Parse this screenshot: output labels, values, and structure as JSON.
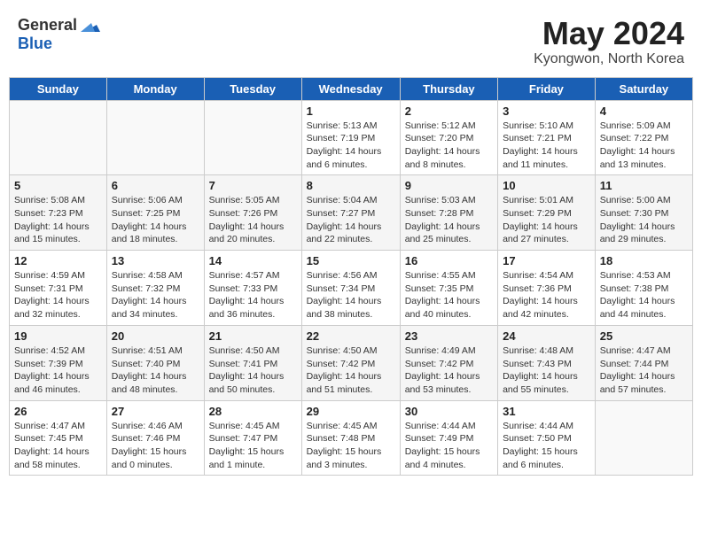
{
  "logo": {
    "general": "General",
    "blue": "Blue"
  },
  "title": {
    "month": "May 2024",
    "location": "Kyongwon, North Korea"
  },
  "days_of_week": [
    "Sunday",
    "Monday",
    "Tuesday",
    "Wednesday",
    "Thursday",
    "Friday",
    "Saturday"
  ],
  "weeks": [
    [
      {
        "day": "",
        "sunrise": "",
        "sunset": "",
        "daylight": ""
      },
      {
        "day": "",
        "sunrise": "",
        "sunset": "",
        "daylight": ""
      },
      {
        "day": "",
        "sunrise": "",
        "sunset": "",
        "daylight": ""
      },
      {
        "day": "1",
        "sunrise": "Sunrise: 5:13 AM",
        "sunset": "Sunset: 7:19 PM",
        "daylight": "Daylight: 14 hours and 6 minutes."
      },
      {
        "day": "2",
        "sunrise": "Sunrise: 5:12 AM",
        "sunset": "Sunset: 7:20 PM",
        "daylight": "Daylight: 14 hours and 8 minutes."
      },
      {
        "day": "3",
        "sunrise": "Sunrise: 5:10 AM",
        "sunset": "Sunset: 7:21 PM",
        "daylight": "Daylight: 14 hours and 11 minutes."
      },
      {
        "day": "4",
        "sunrise": "Sunrise: 5:09 AM",
        "sunset": "Sunset: 7:22 PM",
        "daylight": "Daylight: 14 hours and 13 minutes."
      }
    ],
    [
      {
        "day": "5",
        "sunrise": "Sunrise: 5:08 AM",
        "sunset": "Sunset: 7:23 PM",
        "daylight": "Daylight: 14 hours and 15 minutes."
      },
      {
        "day": "6",
        "sunrise": "Sunrise: 5:06 AM",
        "sunset": "Sunset: 7:25 PM",
        "daylight": "Daylight: 14 hours and 18 minutes."
      },
      {
        "day": "7",
        "sunrise": "Sunrise: 5:05 AM",
        "sunset": "Sunset: 7:26 PM",
        "daylight": "Daylight: 14 hours and 20 minutes."
      },
      {
        "day": "8",
        "sunrise": "Sunrise: 5:04 AM",
        "sunset": "Sunset: 7:27 PM",
        "daylight": "Daylight: 14 hours and 22 minutes."
      },
      {
        "day": "9",
        "sunrise": "Sunrise: 5:03 AM",
        "sunset": "Sunset: 7:28 PM",
        "daylight": "Daylight: 14 hours and 25 minutes."
      },
      {
        "day": "10",
        "sunrise": "Sunrise: 5:01 AM",
        "sunset": "Sunset: 7:29 PM",
        "daylight": "Daylight: 14 hours and 27 minutes."
      },
      {
        "day": "11",
        "sunrise": "Sunrise: 5:00 AM",
        "sunset": "Sunset: 7:30 PM",
        "daylight": "Daylight: 14 hours and 29 minutes."
      }
    ],
    [
      {
        "day": "12",
        "sunrise": "Sunrise: 4:59 AM",
        "sunset": "Sunset: 7:31 PM",
        "daylight": "Daylight: 14 hours and 32 minutes."
      },
      {
        "day": "13",
        "sunrise": "Sunrise: 4:58 AM",
        "sunset": "Sunset: 7:32 PM",
        "daylight": "Daylight: 14 hours and 34 minutes."
      },
      {
        "day": "14",
        "sunrise": "Sunrise: 4:57 AM",
        "sunset": "Sunset: 7:33 PM",
        "daylight": "Daylight: 14 hours and 36 minutes."
      },
      {
        "day": "15",
        "sunrise": "Sunrise: 4:56 AM",
        "sunset": "Sunset: 7:34 PM",
        "daylight": "Daylight: 14 hours and 38 minutes."
      },
      {
        "day": "16",
        "sunrise": "Sunrise: 4:55 AM",
        "sunset": "Sunset: 7:35 PM",
        "daylight": "Daylight: 14 hours and 40 minutes."
      },
      {
        "day": "17",
        "sunrise": "Sunrise: 4:54 AM",
        "sunset": "Sunset: 7:36 PM",
        "daylight": "Daylight: 14 hours and 42 minutes."
      },
      {
        "day": "18",
        "sunrise": "Sunrise: 4:53 AM",
        "sunset": "Sunset: 7:38 PM",
        "daylight": "Daylight: 14 hours and 44 minutes."
      }
    ],
    [
      {
        "day": "19",
        "sunrise": "Sunrise: 4:52 AM",
        "sunset": "Sunset: 7:39 PM",
        "daylight": "Daylight: 14 hours and 46 minutes."
      },
      {
        "day": "20",
        "sunrise": "Sunrise: 4:51 AM",
        "sunset": "Sunset: 7:40 PM",
        "daylight": "Daylight: 14 hours and 48 minutes."
      },
      {
        "day": "21",
        "sunrise": "Sunrise: 4:50 AM",
        "sunset": "Sunset: 7:41 PM",
        "daylight": "Daylight: 14 hours and 50 minutes."
      },
      {
        "day": "22",
        "sunrise": "Sunrise: 4:50 AM",
        "sunset": "Sunset: 7:42 PM",
        "daylight": "Daylight: 14 hours and 51 minutes."
      },
      {
        "day": "23",
        "sunrise": "Sunrise: 4:49 AM",
        "sunset": "Sunset: 7:42 PM",
        "daylight": "Daylight: 14 hours and 53 minutes."
      },
      {
        "day": "24",
        "sunrise": "Sunrise: 4:48 AM",
        "sunset": "Sunset: 7:43 PM",
        "daylight": "Daylight: 14 hours and 55 minutes."
      },
      {
        "day": "25",
        "sunrise": "Sunrise: 4:47 AM",
        "sunset": "Sunset: 7:44 PM",
        "daylight": "Daylight: 14 hours and 57 minutes."
      }
    ],
    [
      {
        "day": "26",
        "sunrise": "Sunrise: 4:47 AM",
        "sunset": "Sunset: 7:45 PM",
        "daylight": "Daylight: 14 hours and 58 minutes."
      },
      {
        "day": "27",
        "sunrise": "Sunrise: 4:46 AM",
        "sunset": "Sunset: 7:46 PM",
        "daylight": "Daylight: 15 hours and 0 minutes."
      },
      {
        "day": "28",
        "sunrise": "Sunrise: 4:45 AM",
        "sunset": "Sunset: 7:47 PM",
        "daylight": "Daylight: 15 hours and 1 minute."
      },
      {
        "day": "29",
        "sunrise": "Sunrise: 4:45 AM",
        "sunset": "Sunset: 7:48 PM",
        "daylight": "Daylight: 15 hours and 3 minutes."
      },
      {
        "day": "30",
        "sunrise": "Sunrise: 4:44 AM",
        "sunset": "Sunset: 7:49 PM",
        "daylight": "Daylight: 15 hours and 4 minutes."
      },
      {
        "day": "31",
        "sunrise": "Sunrise: 4:44 AM",
        "sunset": "Sunset: 7:50 PM",
        "daylight": "Daylight: 15 hours and 6 minutes."
      },
      {
        "day": "",
        "sunrise": "",
        "sunset": "",
        "daylight": ""
      }
    ]
  ]
}
